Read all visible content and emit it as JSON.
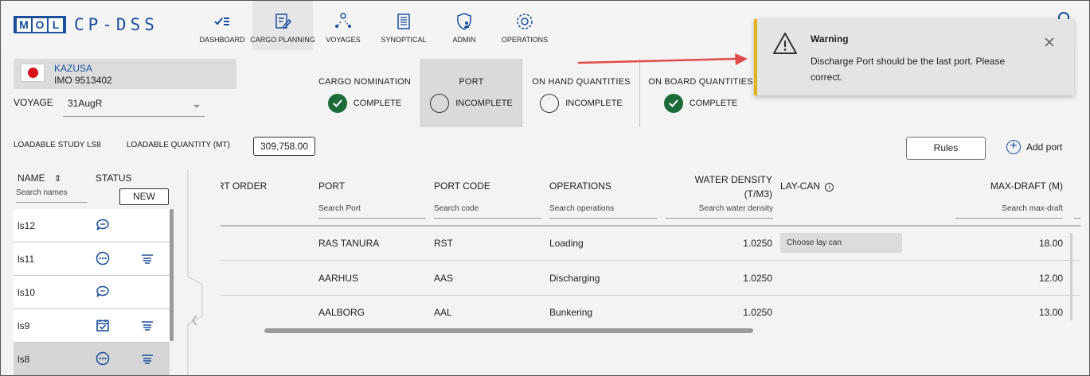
{
  "app": {
    "brand_logo": "MOL",
    "brand_name": "CP-DSS"
  },
  "nav": [
    {
      "label": "DASHBOARD",
      "icon": "dashboard-icon"
    },
    {
      "label": "CARGO PLANNING",
      "icon": "cargo-planning-icon"
    },
    {
      "label": "VOYAGES",
      "icon": "voyages-icon"
    },
    {
      "label": "SYNOPTICAL",
      "icon": "synoptical-icon"
    },
    {
      "label": "ADMIN",
      "icon": "admin-icon"
    },
    {
      "label": "OPERATIONS",
      "icon": "operations-icon"
    }
  ],
  "ship": {
    "name": "KAZUSA",
    "imo": "IMO 9513402",
    "flag": "japan-flag-icon"
  },
  "voyage": {
    "label": "VOYAGE",
    "value": "31AugR"
  },
  "steps": [
    {
      "title": "CARGO NOMINATION",
      "status": "COMPLETE"
    },
    {
      "title": "PORT",
      "status": "INCOMPLETE"
    },
    {
      "title": "ON HAND QUANTITIES",
      "status": "INCOMPLETE"
    },
    {
      "title": "ON BOARD QUANTITIES",
      "status": "COMPLETE"
    }
  ],
  "loadable": {
    "study_label": "LOADABLE STUDY LS8",
    "quantity_label": "LOADABLE QUANTITY (MT)",
    "quantity_value": "309,758.00"
  },
  "buttons": {
    "rules": "Rules",
    "add_port": "Add port",
    "new": "NEW"
  },
  "studies": {
    "name_header": "NAME",
    "status_header": "STATUS",
    "search_placeholder": "Search names",
    "rows": [
      {
        "name": "ls12"
      },
      {
        "name": "ls11"
      },
      {
        "name": "ls10"
      },
      {
        "name": "ls9"
      },
      {
        "name": "ls8"
      }
    ]
  },
  "table": {
    "headers": {
      "order": "RT ORDER",
      "port": "PORT",
      "port_code": "PORT CODE",
      "operations": "OPERATIONS",
      "water_density_1": "WATER DENSITY",
      "water_density_2": "(T/M3)",
      "laycan": "LAY-CAN",
      "max_draft": "MAX-DRAFT (M)"
    },
    "search": {
      "port": "Search Port",
      "port_code": "Search code",
      "operations": "Search operations",
      "water_density": "Search water density",
      "max_draft": "Search max-draft"
    },
    "rows": [
      {
        "port": "RAS TANURA",
        "code": "RST",
        "operation": "Loading",
        "density": "1.0250",
        "laycan": "Choose lay can",
        "max_draft": "18.00"
      },
      {
        "port": "AARHUS",
        "code": "AAS",
        "operation": "Discharging",
        "density": "1.0250",
        "laycan": "",
        "max_draft": "12.00"
      },
      {
        "port": "AALBORG",
        "code": "AAL",
        "operation": "Bunkering",
        "density": "1.0250",
        "laycan": "",
        "max_draft": "13.00"
      }
    ]
  },
  "warning": {
    "title": "Warning",
    "message": "Discharge Port should be the last port. Please correct."
  },
  "colors": {
    "brand": "#1b4f9c",
    "complete": "#1e6b3a",
    "warning": "#e2b320",
    "annotation_arrow": "#e04a4a"
  }
}
